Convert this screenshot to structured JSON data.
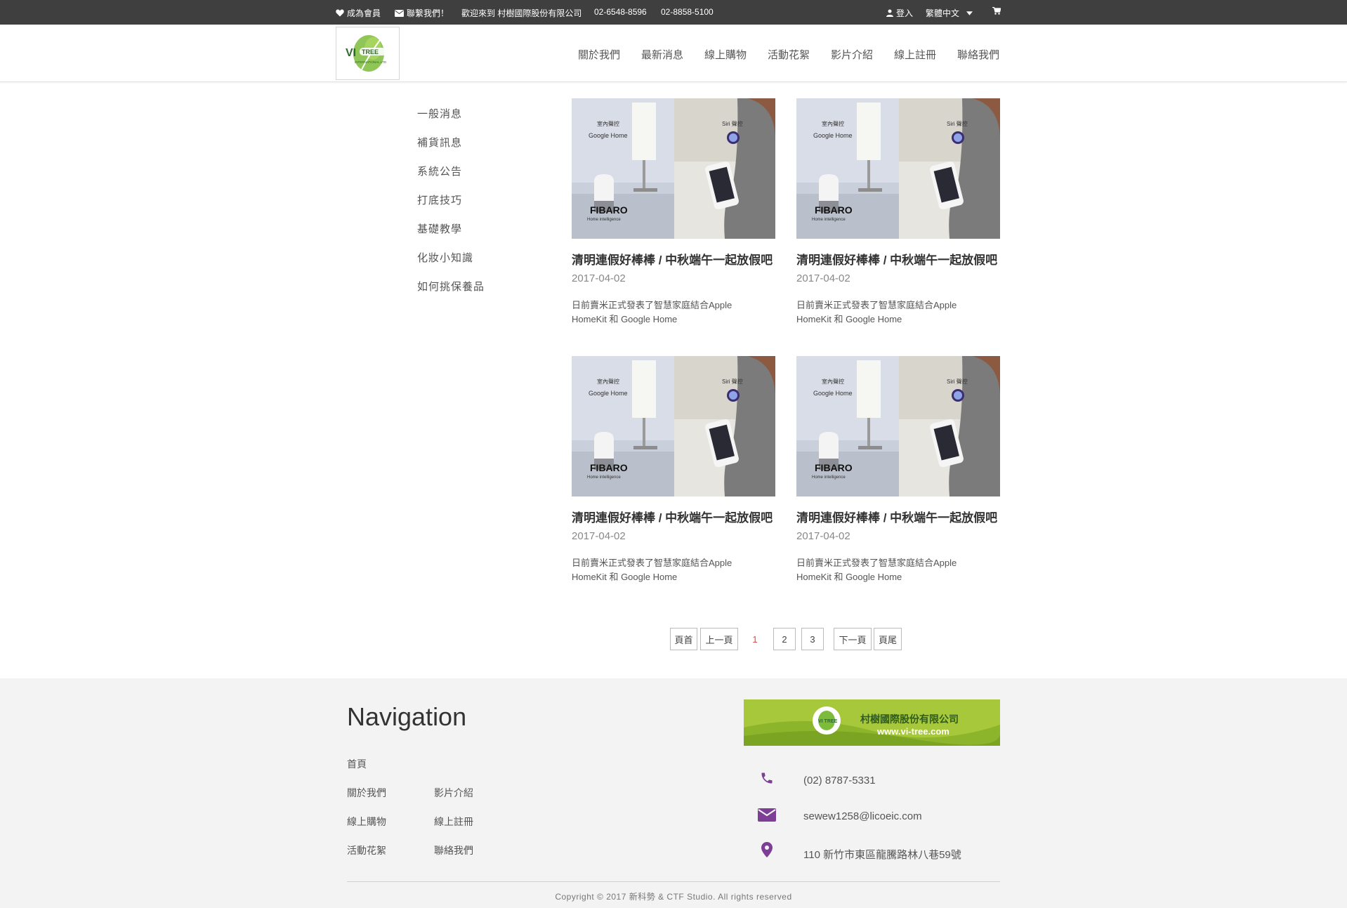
{
  "topbar": {
    "member": "成為會員",
    "contact": "聯繫我們！",
    "welcome": "歡迎來到 村樹國際股份有限公司",
    "phone1": "02-6548-8596",
    "phone2": "02-8858-5100",
    "login": "登入",
    "language": "繁體中文"
  },
  "logo": {
    "brand": "VI TREE",
    "sub": "INTERNATIONAL.LTD"
  },
  "nav": [
    "關於我們",
    "最新消息",
    "線上購物",
    "活動花絮",
    "影片介紹",
    "線上註冊",
    "聯絡我們"
  ],
  "sidebar": [
    "一般消息",
    "補貨訊息",
    "系統公告",
    "打底技巧",
    "基礎教學",
    "化妝小知識",
    "如何挑保養品"
  ],
  "thumbnail": {
    "left_caption": "室內聲控",
    "left_product": "Google Home",
    "right_caption": "Siri 聲控",
    "brand": "FIBARO",
    "brand_sub": "Home intelligence"
  },
  "posts": [
    {
      "title": "清明連假好棒棒 / 中秋端午一起放假吧",
      "date": "2017-04-02",
      "excerpt": "日前賣米正式發表了智慧家庭結合Apple HomeKit 和 Google Home"
    },
    {
      "title": "清明連假好棒棒 / 中秋端午一起放假吧",
      "date": "2017-04-02",
      "excerpt": "日前賣米正式發表了智慧家庭結合Apple HomeKit 和 Google Home"
    },
    {
      "title": "清明連假好棒棒 / 中秋端午一起放假吧",
      "date": "2017-04-02",
      "excerpt": "日前賣米正式發表了智慧家庭結合Apple HomeKit 和 Google Home"
    },
    {
      "title": "清明連假好棒棒 / 中秋端午一起放假吧",
      "date": "2017-04-02",
      "excerpt": "日前賣米正式發表了智慧家庭結合Apple HomeKit 和 Google Home"
    }
  ],
  "pagination": {
    "first": "頁首",
    "prev": "上一頁",
    "pages": [
      "1",
      "2",
      "3"
    ],
    "current": "1",
    "next": "下一頁",
    "last": "頁尾"
  },
  "footer": {
    "nav_title": "Navigation",
    "links": {
      "home": "首頁",
      "about": "關於我們",
      "videos": "影片介紹",
      "shop": "線上購物",
      "register": "線上註冊",
      "events": "活動花絮",
      "contact": "聯絡我們"
    },
    "banner": {
      "company": "村樹國際股份有限公司",
      "url": "www.vi-tree.com"
    },
    "phone": "(02) 8787-5331",
    "email": "sewew1258@licoeic.com",
    "address": "110 新竹市東區龍騰路林八巷59號",
    "copyright": "Copyright © 2017 新科勢 & CTF Studio. All rights reserved"
  },
  "colors": {
    "accent_purple": "#7c3f95",
    "topbar": "#3f3f3f",
    "banner_green": "#a6c83a",
    "current_page": "#e04848"
  }
}
